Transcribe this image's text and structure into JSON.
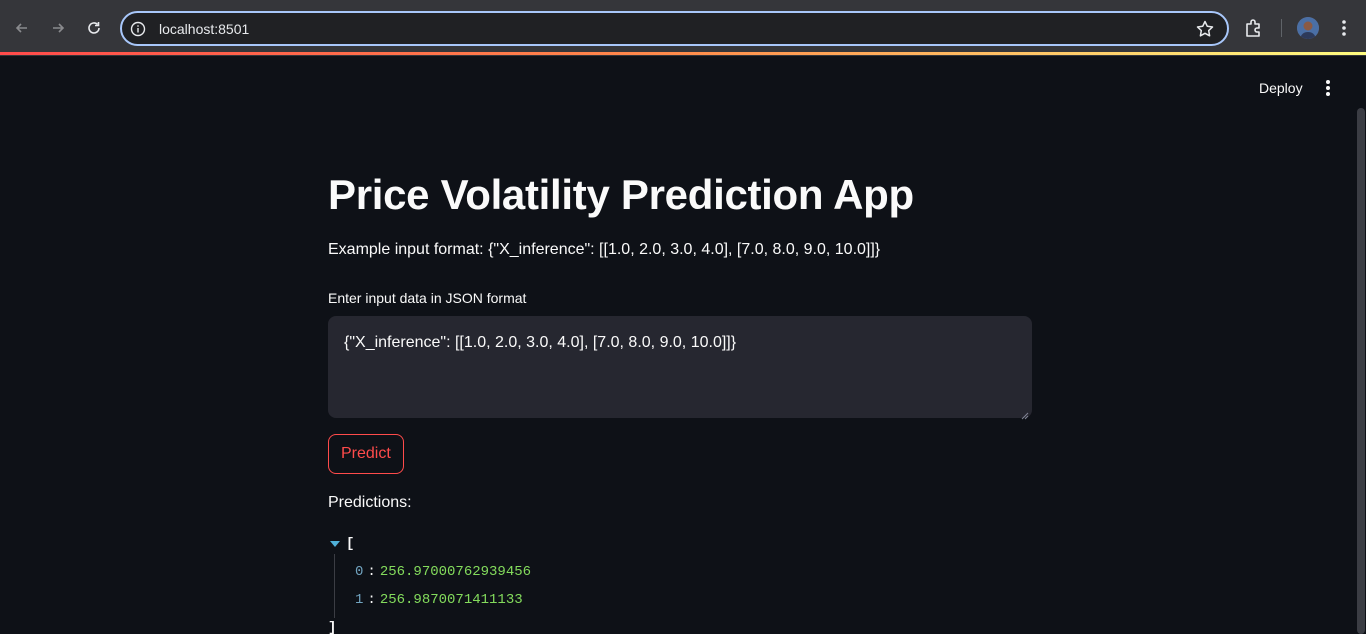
{
  "browser": {
    "url": "localhost:8501",
    "icons": [
      "back-icon",
      "forward-icon",
      "reload-icon",
      "site-info-icon",
      "bookmark-star-icon",
      "extensions-icon",
      "profile-avatar",
      "browser-menu-icon"
    ]
  },
  "header": {
    "deploy_label": "Deploy"
  },
  "main": {
    "title": "Price Volatility Prediction App",
    "example_text": "Example input format: {\"X_inference\": [[1.0, 2.0, 3.0, 4.0], [7.0, 8.0, 9.0, 10.0]]}",
    "input_label": "Enter input data in JSON format",
    "input_value": "{\"X_inference\": [[1.0, 2.0, 3.0, 4.0], [7.0, 8.0, 9.0, 10.0]]}",
    "predict_label": "Predict",
    "predictions_label": "Predictions:",
    "json_open": "[",
    "json_close": "]",
    "predictions": [
      {
        "key": "0",
        "value": "256.97000762939456"
      },
      {
        "key": "1",
        "value": "256.9870071411133"
      }
    ]
  },
  "colors": {
    "accent": "#ff4b4b",
    "background": "#0e1117",
    "input_bg": "#262730"
  }
}
